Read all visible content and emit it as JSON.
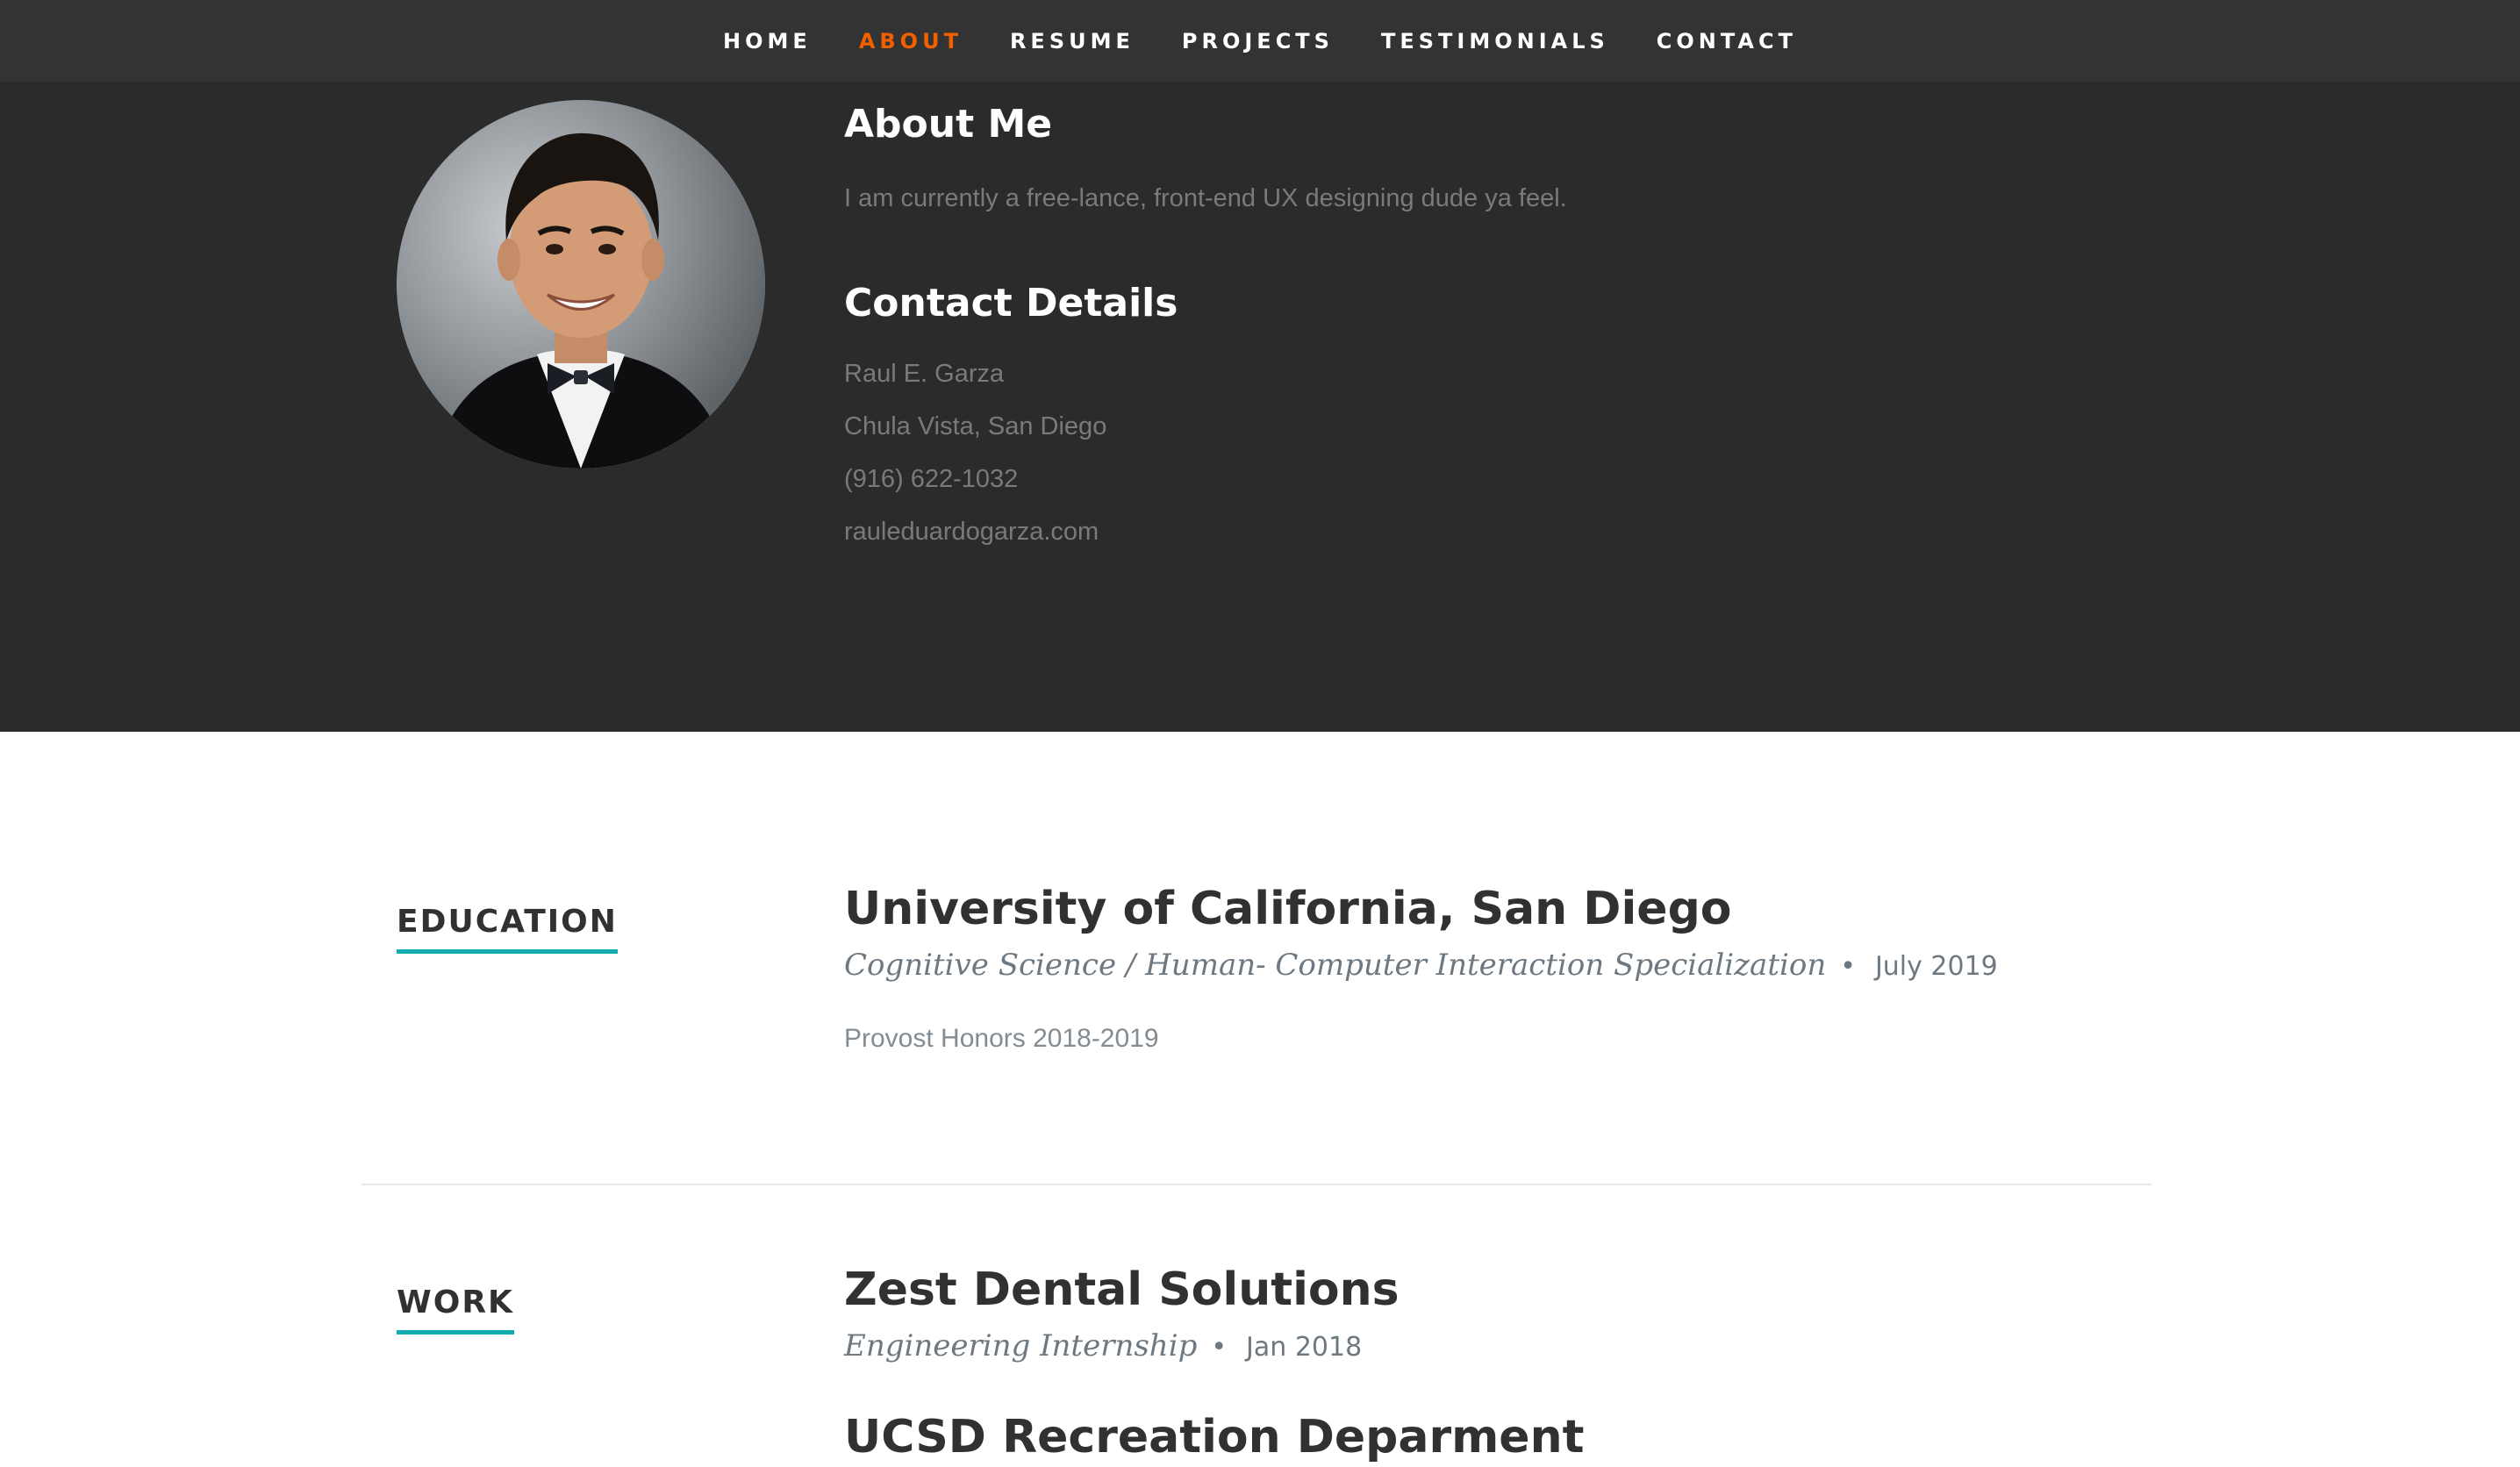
{
  "nav": {
    "items": [
      {
        "label": "HOME",
        "active": false
      },
      {
        "label": "ABOUT",
        "active": true
      },
      {
        "label": "RESUME",
        "active": false
      },
      {
        "label": "PROJECTS",
        "active": false
      },
      {
        "label": "TESTIMONIALS",
        "active": false
      },
      {
        "label": "CONTACT",
        "active": false
      }
    ],
    "active_color": "#f06000"
  },
  "about": {
    "heading": "About Me",
    "bio": "I am currently a free-lance, front-end UX designing dude ya feel.",
    "contact_heading": "Contact Details",
    "contact": {
      "name": "Raul E. Garza",
      "location": "Chula Vista, San Diego",
      "phone": "(916) 622-1032",
      "website": "rauleduardogarza.com"
    }
  },
  "resume": {
    "education": {
      "label": "EDUCATION",
      "school": "University of California, San Diego",
      "degree": "Cognitive Science / Human- Computer Interaction Specialization",
      "date": "July 2019",
      "description": "Provost Honors 2018-2019"
    },
    "work": {
      "label": "WORK",
      "jobs": [
        {
          "company": "Zest Dental Solutions",
          "title": "Engineering Internship",
          "date": "Jan 2018"
        },
        {
          "company": "UCSD Recreation Deparment",
          "title": "",
          "date": ""
        }
      ]
    }
  },
  "colors": {
    "nav_bg": "#333333",
    "about_bg": "#2b2b2b",
    "underline": "#11abb0",
    "heading": "#313131"
  },
  "bullet": "•"
}
